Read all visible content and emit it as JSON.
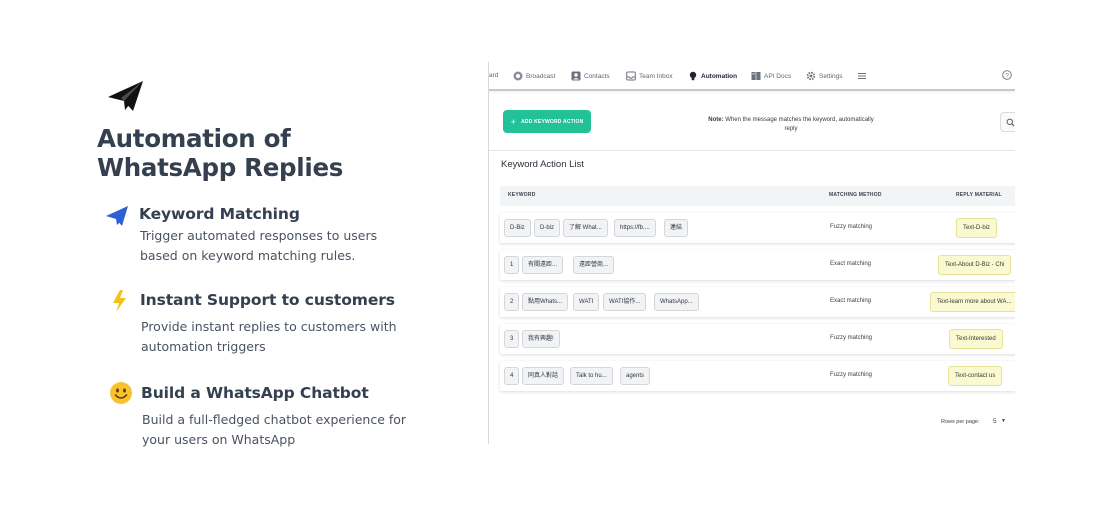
{
  "hero": {
    "title": "Automation of WhatsApp Replies",
    "icon": "paper-plane-icon"
  },
  "features": [
    {
      "icon": "paper-plane-icon",
      "title": "Keyword Matching",
      "description": "Trigger automated responses to users based on keyword matching rules."
    },
    {
      "icon": "lightning-bolt-icon",
      "title": "Instant Support to customers",
      "description": "Provide instant replies to customers with automation triggers"
    },
    {
      "icon": "smiley-face-icon",
      "title": "Build a WhatsApp Chatbot",
      "description": "Build a full-fledged chatbot experience for your users on WhatsApp"
    }
  ],
  "app": {
    "nav": {
      "first_partial": "ard",
      "items": [
        {
          "label": "Broadcast",
          "icon": "broadcast-icon"
        },
        {
          "label": "Contacts",
          "icon": "contacts-icon"
        },
        {
          "label": "Team Inbox",
          "icon": "inbox-icon"
        },
        {
          "label": "Automation",
          "icon": "bulb-icon",
          "active": true
        },
        {
          "label": "API Docs",
          "icon": "book-icon"
        },
        {
          "label": "Settings",
          "icon": "gear-icon"
        }
      ],
      "menu_icon": "hamburger-icon",
      "help_icon": "help-icon"
    },
    "add_button": {
      "plus": "+",
      "label": "ADD KEYWORD ACTION"
    },
    "note": {
      "label": "Note:",
      "text": "When the message matches the keyword, automatically reply"
    },
    "list_title": "Keyword Action List",
    "columns": {
      "keyword": "KEYWORD",
      "method": "MATCHING METHOD",
      "reply": "REPLY MATERIAL"
    },
    "rows": [
      {
        "keywords": [
          "D-Biz",
          "D-biz",
          "了解 What...",
          "https://fb....",
          "連結"
        ],
        "method": "Fuzzy matching",
        "reply": "Text-D-biz"
      },
      {
        "keywords": [
          "1",
          "有關遠距...",
          "遠距營商..."
        ],
        "method": "Exact matching",
        "reply": "Text-About D-Biz - Chi"
      },
      {
        "keywords": [
          "2",
          "點用Whats...",
          "WATI",
          "WATI協作...",
          "WhatsApp..."
        ],
        "method": "Exact matching",
        "reply": "Text-learn more about WA..."
      },
      {
        "keywords": [
          "3",
          "我有興趣!"
        ],
        "method": "Fuzzy matching",
        "reply": "Text-Interested"
      },
      {
        "keywords": [
          "4",
          "同真人對話",
          "Talk to hu...",
          "agents"
        ],
        "method": "Fuzzy matching",
        "reply": "Text-contact us"
      }
    ],
    "pagination": {
      "rows_per_page_label": "Rows per page:",
      "rows_per_page_value": "5"
    }
  },
  "colors": {
    "accent_green": "#23c197",
    "heading": "#34404f",
    "plane_blue": "#2f5fd6",
    "bolt_yellow": "#f2c21b",
    "smiley_yellow": "#f7c22e",
    "reply_bg": "#fbf9d1"
  }
}
